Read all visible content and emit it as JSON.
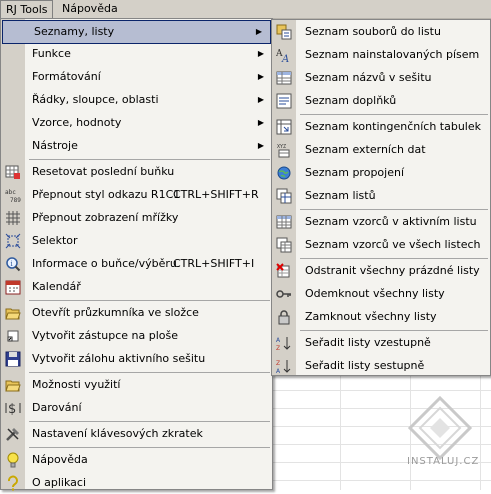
{
  "menubar": {
    "items": [
      "RJ Tools",
      "Nápověda"
    ]
  },
  "main_menu": {
    "items": [
      {
        "label": "Seznamy, listy"
      },
      {
        "label": "Funkce"
      },
      {
        "label": "Formátování"
      },
      {
        "label": "Řádky, sloupce, oblasti"
      },
      {
        "label": "Vzorce, hodnoty"
      },
      {
        "label": "Nástroje"
      },
      {
        "label": "Resetovat poslední buňku"
      },
      {
        "label": "Přepnout styl odkazu R1C1",
        "shortcut": "CTRL+SHIFT+R"
      },
      {
        "label": "Přepnout zobrazení mřížky"
      },
      {
        "label": "Selektor"
      },
      {
        "label": "Informace o buňce/výběru",
        "shortcut": "CTRL+SHIFT+I"
      },
      {
        "label": "Kalendář"
      },
      {
        "label": "Otevřít průzkumníka ve složce"
      },
      {
        "label": "Vytvořit zástupce na ploše"
      },
      {
        "label": "Vytvořit zálohu aktivního sešitu"
      },
      {
        "label": "Možnosti využití"
      },
      {
        "label": "Darování"
      },
      {
        "label": "Nastavení klávesových zkratek"
      },
      {
        "label": "Nápověda"
      },
      {
        "label": "O aplikaci"
      }
    ],
    "icon_glyphs": {
      "abc": "abc",
      "num": "789",
      "dollar": "$"
    }
  },
  "sub_menu": {
    "items": [
      {
        "label": "Seznam souborů do listu"
      },
      {
        "label": "Seznam nainstalovaných písem"
      },
      {
        "label": "Seznam názvů v sešitu"
      },
      {
        "label": "Seznam doplňků"
      },
      {
        "label": "Seznam kontingenčních tabulek"
      },
      {
        "label": "Seznam externích dat"
      },
      {
        "label": "Seznam propojení"
      },
      {
        "label": "Seznam listů"
      },
      {
        "label": "Seznam vzorců v aktivním listu"
      },
      {
        "label": "Seznam vzorců ve všech listech"
      },
      {
        "label": "Odstranit všechny prázdné listy"
      },
      {
        "label": "Odemknout všechny listy"
      },
      {
        "label": "Zamknout všechny listy"
      },
      {
        "label": "Seřadit listy vzestupně"
      },
      {
        "label": "Seřadit listy sestupně"
      }
    ],
    "icon_glyphs": {
      "xyz": "XYZ",
      "az": "AZ",
      "za": "ZA"
    }
  },
  "watermark": {
    "text": "INSTALUJ.CZ"
  },
  "colors": {
    "menu_bg": "#f4f3ef",
    "gutter": "#d4d0c8",
    "highlight": "#b6bdd2",
    "highlight_border": "#0a246a"
  }
}
